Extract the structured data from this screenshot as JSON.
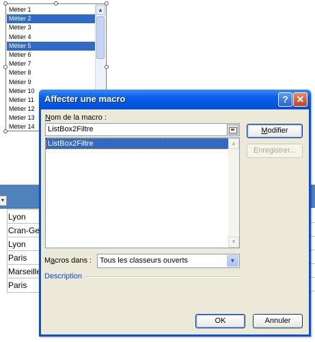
{
  "listbox": {
    "items": [
      {
        "label": "Métier 1",
        "selected": false
      },
      {
        "label": "Métier 2",
        "selected": true
      },
      {
        "label": "Métier 3",
        "selected": false
      },
      {
        "label": "Métier 4",
        "selected": false
      },
      {
        "label": "Métier 5",
        "selected": true
      },
      {
        "label": "Métier 6",
        "selected": false
      },
      {
        "label": "Métier 7",
        "selected": false
      },
      {
        "label": "Métier 8",
        "selected": false
      },
      {
        "label": "Métier 9",
        "selected": false
      },
      {
        "label": "Métier 10",
        "selected": false
      },
      {
        "label": "Métier 11",
        "selected": false
      },
      {
        "label": "Métier 12",
        "selected": false
      },
      {
        "label": "Métier 13",
        "selected": false
      },
      {
        "label": "Métier 14",
        "selected": false
      }
    ]
  },
  "sheet": {
    "cities": [
      "Lyon",
      "Cran-Gevrier",
      "Lyon",
      "Paris",
      "Marseille",
      "Paris"
    ]
  },
  "dialog": {
    "title": "Affecter une macro",
    "help_glyph": "?",
    "close_glyph": "✕",
    "macro_name_label_u": "N",
    "macro_name_label_rest": "om de la macro :",
    "macro_name_value": "ListBox2Filtre",
    "macro_list": [
      "ListBox2Filtre"
    ],
    "macros_in_label_u": "a",
    "macros_in_label_pre": "M",
    "macros_in_label_rest": "cros dans :",
    "macros_in_value": "Tous les classeurs ouverts",
    "description_label": "Description",
    "modify_label_u": "M",
    "modify_label_rest": "odifier",
    "save_label": "Enregistrer...",
    "ok_label": "OK",
    "cancel_label": "Annuler"
  },
  "colors": {
    "selection": "#316ac5",
    "titlebar": "#0a5ee8",
    "table_header": "#4f81bd",
    "description_link": "#0046d5"
  }
}
